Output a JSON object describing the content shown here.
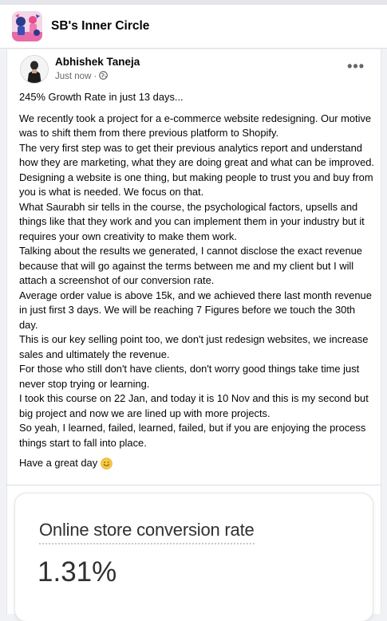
{
  "group": {
    "name": "SB's Inner Circle",
    "avatar_icon": "group-cover-illustration"
  },
  "post": {
    "author": "Abhishek Taneja",
    "time": "Just now",
    "separator": "·",
    "audience_icon": "globe-icon",
    "more_icon": "•••",
    "headline": "245% Growth Rate in just 13 days...",
    "body": "We recently took a project for a e-commerce website redesigning. Our motive was to shift them from there previous platform to Shopify.\nThe very first step was to get their previous analytics report and understand how they are marketing, what they are doing great and what can be improved.\nDesigning a website is one thing, but making people to trust you and buy from you is what is needed. We focus on that.\nWhat Saurabh sir tells in the course, the psychological factors, upsells and things like that they work and you can implement them in your industry but it requires your own creativity to make them work.\nTalking about the results we generated, I cannot disclose the exact revenue because that will go against the terms between me and my client but I will attach a screenshot of our conversion rate.\nAverage order value is above 15k, and we achieved there last month revenue in just first 3 days. We will be reaching 7 Figures before we touch the 30th day.\nThis is our key selling point too, we don't just redesign websites, we increase sales and ultimately the revenue.\nFor those who still don't have clients, don't worry good things take time just never stop trying or learning.\nI took this course on 22 Jan, and today it is 10 Nov and this is my second but big project and now we are lined up with more projects.\nSo yeah, I learned, failed, learned, failed, but if you are enjoying the process things start to fall into place.",
    "signoff": "Have a great day",
    "signoff_emoji": "smiling-face-emoji"
  },
  "attachment": {
    "title": "Online store conversion rate",
    "value": "1.31%"
  },
  "colors": {
    "background": "#f0f2f5",
    "card": "#ffffff",
    "text": "#050505",
    "secondary_text": "#65676b"
  }
}
